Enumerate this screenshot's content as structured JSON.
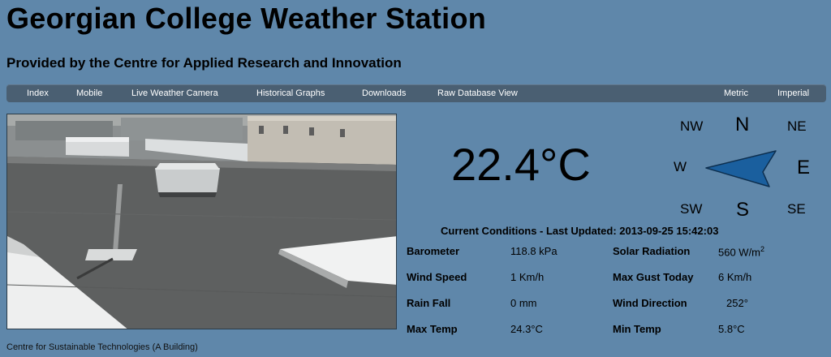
{
  "header": {
    "title": "Georgian College Weather Station",
    "subtitle": "Provided by the Centre for Applied Research and Innovation"
  },
  "nav": {
    "left": [
      "Index",
      "Mobile",
      "Live Weather Camera",
      "Historical Graphs",
      "Downloads",
      "Raw Database View"
    ],
    "right": [
      "Metric",
      "Imperial"
    ]
  },
  "camera": {
    "caption": "Centre for Sustainable Technologies (A Building)"
  },
  "current": {
    "temperature": "22.4°C",
    "heading": "Current Conditions - Last Updated: 2013-09-25 15:42:03"
  },
  "compass": {
    "n": "N",
    "ne": "NE",
    "e": "E",
    "se": "SE",
    "s": "S",
    "sw": "SW",
    "w": "W",
    "nw": "NW",
    "arrow_color": "#1a5f9e"
  },
  "conditions": {
    "barometer_label": "Barometer",
    "barometer_value": "118.8 kPa",
    "solar_label": "Solar Radiation",
    "solar_value": "560 W/m",
    "solar_unit_exp": "2",
    "wind_speed_label": "Wind Speed",
    "wind_speed_value": "1 Km/h",
    "max_gust_label": "Max Gust Today",
    "max_gust_value": "6 Km/h",
    "rain_label": "Rain Fall",
    "rain_value": "0 mm",
    "wind_dir_label": "Wind Direction",
    "wind_dir_value": "252°",
    "max_temp_label": "Max Temp",
    "max_temp_value": "24.3°C",
    "min_temp_label": "Min Temp",
    "min_temp_value": "5.8°C"
  },
  "colors": {
    "background": "#5f87aa",
    "navbar": "#4a5f72"
  }
}
